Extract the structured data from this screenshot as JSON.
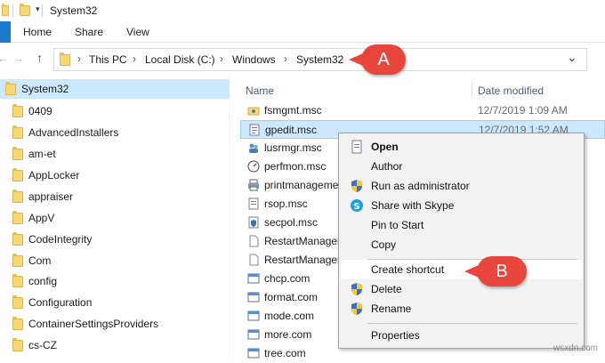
{
  "window": {
    "title": "System32",
    "quick_access_dropdown": "▾"
  },
  "ribbon": {
    "tabs": [
      "Home",
      "Share",
      "View"
    ]
  },
  "nav": {
    "back": "←",
    "forward": "→",
    "up": "↑",
    "breadcrumbs": [
      "This PC",
      "Local Disk (C:)",
      "Windows",
      "System32"
    ],
    "separator": "›",
    "dropdown": "⌄"
  },
  "sidebar": {
    "root": "System32",
    "items": [
      "0409",
      "AdvancedInstallers",
      "am-et",
      "AppLocker",
      "appraiser",
      "AppV",
      "CodeIntegrity",
      "Com",
      "config",
      "Configuration",
      "ContainerSettingsProviders",
      "cs-CZ"
    ]
  },
  "columns": {
    "name": "Name",
    "date": "Date modified"
  },
  "files": [
    {
      "name": "fsmgmt.msc",
      "date": "12/7/2019 1:09 AM",
      "icon": "folder-share-icon"
    },
    {
      "name": "gpedit.msc",
      "date": "12/7/2019 1:52 AM",
      "icon": "policy-doc-icon"
    },
    {
      "name": "lusrmgr.msc",
      "date": "",
      "icon": "users-icon"
    },
    {
      "name": "perfmon.msc",
      "date": "",
      "icon": "perf-icon"
    },
    {
      "name": "printmanageme",
      "date": "",
      "icon": "printer-icon"
    },
    {
      "name": "rsop.msc",
      "date": "",
      "icon": "policy-doc-icon"
    },
    {
      "name": "secpol.msc",
      "date": "",
      "icon": "secpol-icon"
    },
    {
      "name": "RestartManager",
      "date": "",
      "icon": "file-icon"
    },
    {
      "name": "RestartManager",
      "date": "",
      "icon": "file-icon"
    },
    {
      "name": "chcp.com",
      "date": "",
      "icon": "app-icon"
    },
    {
      "name": "format.com",
      "date": "",
      "icon": "app-icon"
    },
    {
      "name": "mode.com",
      "date": "",
      "icon": "app-icon"
    },
    {
      "name": "more.com",
      "date": "",
      "icon": "app-icon"
    },
    {
      "name": "tree.com",
      "date": "",
      "icon": "app-icon"
    }
  ],
  "context_menu": {
    "open": "Open",
    "author": "Author",
    "run_as_admin": "Run as administrator",
    "share_skype": "Share with Skype",
    "pin_start": "Pin to Start",
    "copy": "Copy",
    "create_shortcut": "Create shortcut",
    "delete": "Delete",
    "rename": "Rename",
    "properties": "Properties"
  },
  "callouts": {
    "a": "A",
    "b": "B"
  },
  "watermark": "wsxdn.com",
  "colors": {
    "accent": "#1979ca",
    "selection": "#cce8ff",
    "callout": "#e8453c",
    "folder": "#f8d775"
  }
}
